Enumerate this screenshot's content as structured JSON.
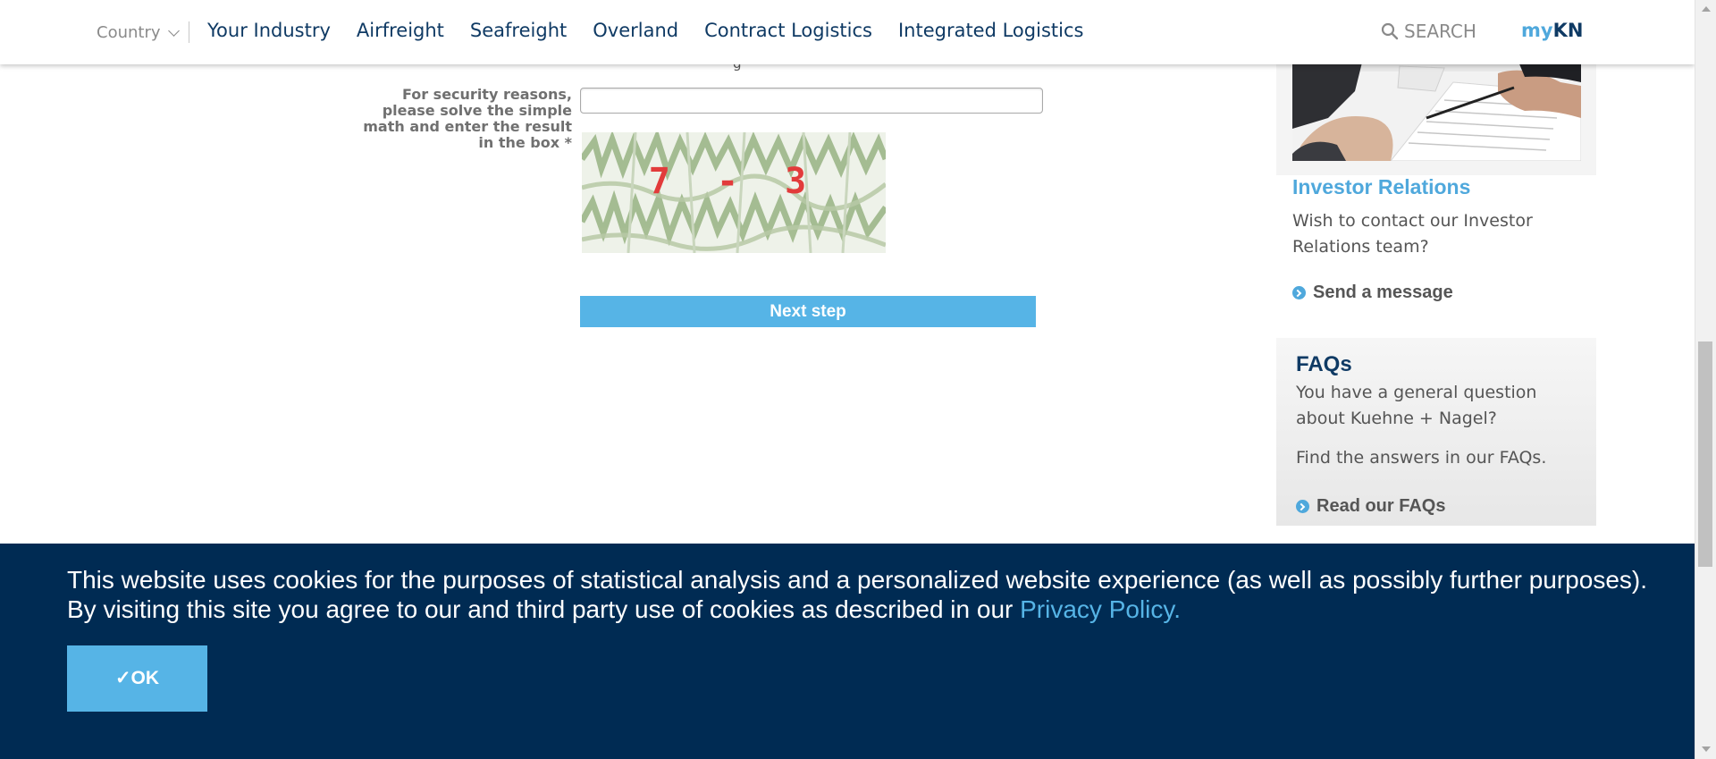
{
  "nav": {
    "country": "Country",
    "links": [
      "Your Industry",
      "Airfreight",
      "Seafreight",
      "Overland",
      "Contract Logistics",
      "Integrated Logistics"
    ],
    "search": "SEARCH",
    "mykn_my": "my",
    "mykn_kn": "KN"
  },
  "form": {
    "cut_text": "g",
    "math_label": "For security reasons, please solve the simple math and enter the result in the box *",
    "math_value": "",
    "captcha_text": "7 - 3",
    "next_button": "Next step"
  },
  "sidebar": {
    "investor": {
      "title": "Investor Relations",
      "description": "Wish to contact our Investor Relations team?",
      "link": "Send a message"
    },
    "faq": {
      "title": "FAQs",
      "description": "You have a general question about Kuehne + Nagel?",
      "description2": "Find the answers in our FAQs.",
      "link": "Read our FAQs"
    }
  },
  "cookie": {
    "text": "This website uses cookies for the purposes of statistical analysis and a personalized website experience (as well as possibly further purposes). By visiting this site you agree to our and third party use of cookies as described in our ",
    "link": "Privacy Policy.",
    "ok": "✓OK"
  },
  "colors": {
    "navy": "#002b53",
    "accent_blue": "#56b4e6",
    "nav_text": "#0f3a64"
  }
}
